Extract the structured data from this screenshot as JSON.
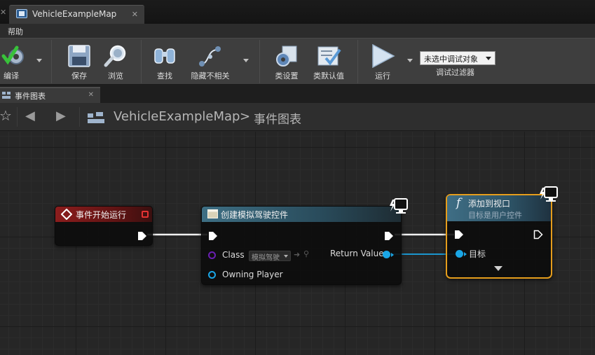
{
  "window": {
    "tab_label": "VehicleExampleMap"
  },
  "menu": {
    "help": "帮助"
  },
  "toolbar": {
    "compile": "编译",
    "save": "保存",
    "browse": "浏览",
    "find": "查找",
    "hide_unrelated": "隐藏不相关",
    "class_settings": "类设置",
    "class_defaults": "类默认值",
    "run": "运行",
    "debug_object": "未选中调试对象",
    "debug_filter": "调试过滤器"
  },
  "panel_tab": {
    "label": "事件图表"
  },
  "breadcrumb": {
    "map": "VehicleExampleMap",
    "separator": ">",
    "graph": "事件图表"
  },
  "nodes": {
    "begin_play": {
      "title": "事件开始运行",
      "color": "#8c1d1d"
    },
    "create_widget": {
      "title": "创建模拟驾驶控件",
      "class_label": "Class",
      "class_value": "模拟驾驶",
      "owning_player": "Owning Player",
      "return_value": "Return Value",
      "color": "#3e6f84"
    },
    "add_to_viewport": {
      "title": "添加到视口",
      "subtitle": "目标是用户控件",
      "target": "目标",
      "highlight": "#e59d1c"
    }
  },
  "colors": {
    "object_pin": "#1aa6e6",
    "class_pin": "#6a1fb3",
    "exec_wire": "#f0f0f0"
  }
}
